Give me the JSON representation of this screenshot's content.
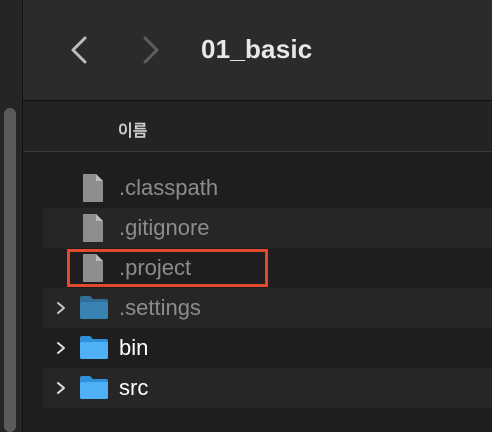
{
  "window": {
    "title": "01_basic"
  },
  "header": {
    "name_column": "이름"
  },
  "items": [
    {
      "name": ".classpath",
      "kind": "file",
      "hidden": true
    },
    {
      "name": ".gitignore",
      "kind": "file",
      "hidden": true
    },
    {
      "name": ".project",
      "kind": "file",
      "hidden": true,
      "annotated": true
    },
    {
      "name": ".settings",
      "kind": "folder",
      "hidden": true
    },
    {
      "name": "bin",
      "kind": "folder",
      "hidden": false
    },
    {
      "name": "src",
      "kind": "folder",
      "hidden": false
    }
  ],
  "colors": {
    "accent_annotation": "#e14a2f",
    "folder_blue": "#3ea2f0",
    "file_gray": "#9a9a9a"
  }
}
